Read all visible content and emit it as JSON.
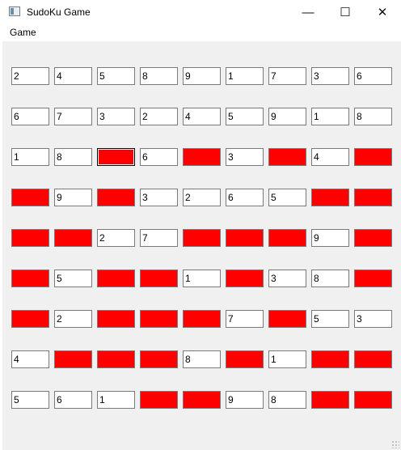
{
  "window": {
    "title": "SudoKu Game",
    "controls": {
      "minimize": "—",
      "maximize": "☐",
      "close": "✕"
    }
  },
  "menu": {
    "items": [
      "Game"
    ]
  },
  "colors": {
    "empty_cell": "#ff0000",
    "cell_bg": "#ffffff",
    "client_bg": "#f0f0f0"
  },
  "grid": {
    "focused": [
      2,
      2
    ],
    "rows": [
      [
        "2",
        "4",
        "5",
        "8",
        "9",
        "1",
        "7",
        "3",
        "6"
      ],
      [
        "6",
        "7",
        "3",
        "2",
        "4",
        "5",
        "9",
        "1",
        "8"
      ],
      [
        "1",
        "8",
        "",
        "6",
        "",
        "3",
        "",
        "4",
        ""
      ],
      [
        "",
        "9",
        "",
        "3",
        "2",
        "6",
        "5",
        "",
        ""
      ],
      [
        "",
        "",
        "2",
        "7",
        "",
        "",
        "",
        "9",
        ""
      ],
      [
        "",
        "5",
        "",
        "",
        "1",
        "",
        "3",
        "8",
        ""
      ],
      [
        "",
        "2",
        "",
        "",
        "",
        "7",
        "",
        "5",
        "3"
      ],
      [
        "4",
        "",
        "",
        "",
        "8",
        "",
        "1",
        "",
        ""
      ],
      [
        "5",
        "6",
        "1",
        "",
        "",
        "9",
        "8",
        "",
        ""
      ]
    ]
  }
}
